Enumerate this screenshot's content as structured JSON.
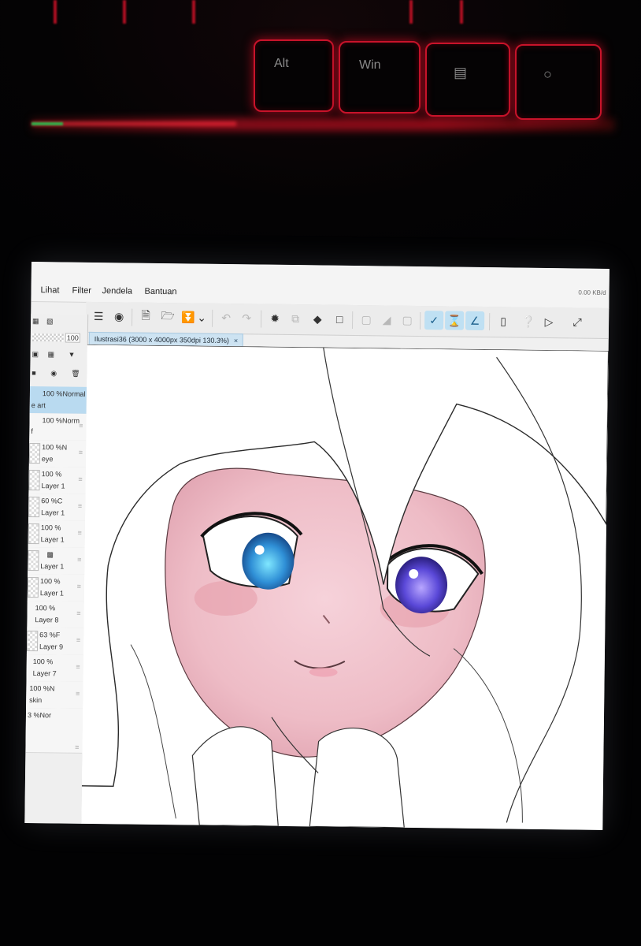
{
  "keyboard": {
    "keys": [
      "Alt",
      "Win",
      "",
      ""
    ]
  },
  "app": {
    "menu": [
      "Lihat",
      "Filter",
      "Jendela",
      "Bantuan"
    ],
    "window_controls": "0.00\nKB/d"
  },
  "document_tab": {
    "title": "Ilustrasi36 (3000 x 4000px 350dpi 130.3%)",
    "close": "×"
  },
  "toolbar": {
    "icons": [
      "menu-icon",
      "app-logo-icon",
      "new-file-icon",
      "open-folder-icon",
      "save-icon",
      "dropdown-icon",
      "undo-icon",
      "redo-icon",
      "loading-icon",
      "transfer-icon",
      "fill-icon",
      "transform-icon",
      "deselect-icon",
      "invert-icon",
      "clear-icon",
      "pen-icon",
      "brush-icon",
      "eraser-icon",
      "tablet-icon",
      "help-icon",
      "flip-icon",
      "fullscreen-icon"
    ]
  },
  "layer_panel": {
    "opacity_value": "100",
    "blend_header": "100 %Normal",
    "layers": [
      {
        "opacity": "",
        "name": "e art",
        "active": true
      },
      {
        "opacity": "100 %Norm",
        "name": "f",
        "active": false
      },
      {
        "opacity": "100 %N",
        "name": "eye",
        "active": false
      },
      {
        "opacity": "100 %",
        "name": "Layer 1",
        "active": false
      },
      {
        "opacity": "60 %C",
        "name": "Layer 1",
        "active": false
      },
      {
        "opacity": "100 %",
        "name": "Layer 1",
        "active": false
      },
      {
        "opacity": "",
        "name": "Layer 1",
        "active": false
      },
      {
        "opacity": "100 %",
        "name": "Layer 1",
        "active": false
      },
      {
        "opacity": "100 %",
        "name": "Layer 8",
        "active": false
      },
      {
        "opacity": "63 %F",
        "name": "Layer 9",
        "active": false
      },
      {
        "opacity": "100 %",
        "name": "Layer 7",
        "active": false
      },
      {
        "opacity": "100 %N",
        "name": "skin",
        "active": false
      },
      {
        "opacity": "3 %Nor",
        "name": "",
        "active": false
      }
    ]
  },
  "colors": {
    "skin": "#f2c7cf",
    "blush": "#e59aa8",
    "eye_left": "#2f8fd6",
    "eye_right": "#5a48d8",
    "key_glow": "#c8132a"
  }
}
